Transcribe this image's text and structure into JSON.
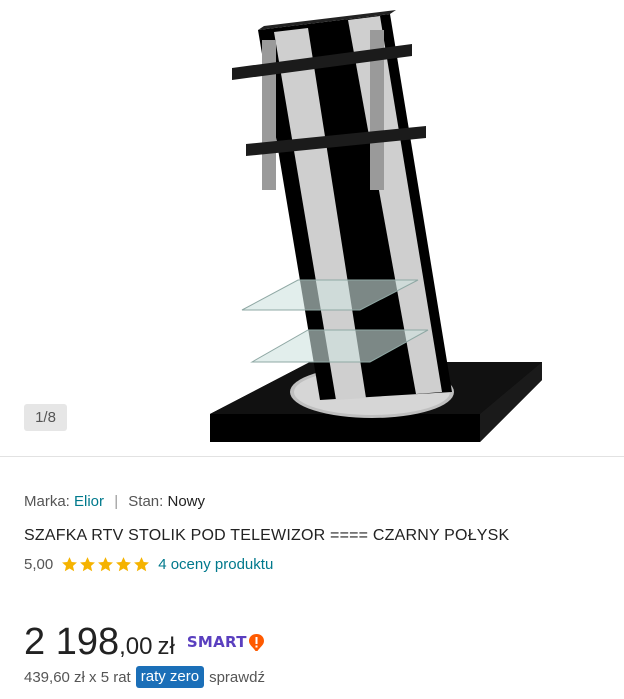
{
  "gallery": {
    "counter": "1/8",
    "image_icon": "tv-stand-product-photo"
  },
  "product": {
    "brand_label": "Marka:",
    "brand_value": "Elior",
    "separator": "|",
    "condition_label": "Stan:",
    "condition_value": "Nowy",
    "title": "SZAFKA RTV STOLIK POD TELEWIZOR ==== CZARNY POŁYSK"
  },
  "rating": {
    "score": "5,00",
    "stars": 5,
    "max_stars": 5,
    "reviews_link": "4 oceny produktu",
    "star_color": "#f5b301"
  },
  "price": {
    "integer": "2 198",
    "decimal": ",00",
    "currency": "zł",
    "smart_label": "SMART",
    "smart_icon": "smart-delivery-badge-icon"
  },
  "installment": {
    "text": "439,60 zł x 5 rat",
    "badge": "raty zero",
    "check_link": "sprawdź"
  },
  "colors": {
    "link": "#00798c",
    "badge": "#1b6fb8",
    "smart": "#5a3fbf",
    "smart_mark": "#ff5a00"
  }
}
